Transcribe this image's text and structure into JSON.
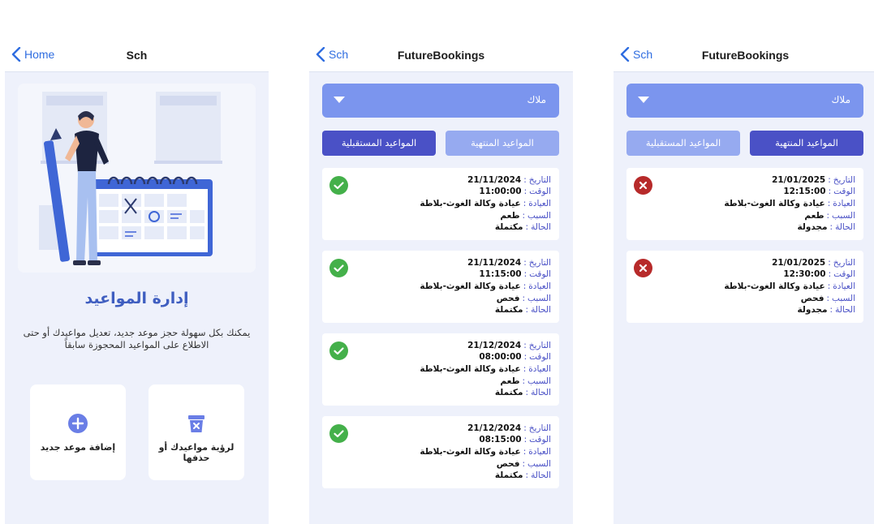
{
  "screen_home": {
    "nav": {
      "back_label": "Home",
      "title": "Sch"
    },
    "title": "إدارة المواعيد",
    "description": "يمكنك بكل سهولة حجز موعد جديد، تعديل مواعيدك أو حتى الاطلاع على المواعيد المحجوزة سابقاً",
    "buttons": [
      {
        "label": "إضافة موعد جديد",
        "icon": "plus-circle-icon"
      },
      {
        "label": "لرؤية مواعيدك أو حذفها",
        "icon": "trash-x-icon"
      }
    ]
  },
  "labels": {
    "date": "التاريخ",
    "time": "الوقت",
    "clinic": "العيادة",
    "reason": "السبب",
    "status": "الحالة",
    "separator": ":"
  },
  "screen_past": {
    "nav": {
      "back_label": "Sch",
      "title": "FutureBookings"
    },
    "dropdown": {
      "selected": "ملاك",
      "icon": "caret-down-icon"
    },
    "tabs": {
      "future": "المواعيد المستقبلية",
      "ended": "المواعيد المنتهية"
    },
    "active_tab": "future",
    "bookings": [
      {
        "date": "21/11/2024",
        "time": "11:00:00",
        "clinic": "عيادة وكالة الغوث-بلاطة",
        "reason": "طعم",
        "status": "مكتملة",
        "icon": "check-circle-icon"
      },
      {
        "date": "21/11/2024",
        "time": "11:15:00",
        "clinic": "عيادة وكالة الغوث-بلاطة",
        "reason": "فحص",
        "status": "مكتملة",
        "icon": "check-circle-icon"
      },
      {
        "date": "21/12/2024",
        "time": "08:00:00",
        "clinic": "عيادة وكالة الغوث-بلاطة",
        "reason": "طعم",
        "status": "مكتملة",
        "icon": "check-circle-icon"
      },
      {
        "date": "21/12/2024",
        "time": "08:15:00",
        "clinic": "عيادة وكالة الغوث-بلاطة",
        "reason": "فحص",
        "status": "مكتملة",
        "icon": "check-circle-icon"
      }
    ]
  },
  "screen_future": {
    "nav": {
      "back_label": "Sch",
      "title": "FutureBookings"
    },
    "dropdown": {
      "selected": "ملاك",
      "icon": "caret-down-icon"
    },
    "tabs": {
      "future": "المواعيد المستقبلية",
      "ended": "المواعيد المنتهية"
    },
    "active_tab": "ended",
    "bookings": [
      {
        "date": "21/01/2025",
        "time": "12:15:00",
        "clinic": "عيادة وكالة الغوث-بلاطة",
        "reason": "طعم",
        "status": "مجدولة",
        "icon": "x-circle-icon"
      },
      {
        "date": "21/01/2025",
        "time": "12:30:00",
        "clinic": "عيادة وكالة الغوث-بلاطة",
        "reason": "فحص",
        "status": "مجدولة",
        "icon": "x-circle-icon"
      }
    ]
  },
  "colors": {
    "accent": "#4a51c6",
    "accent_light": "#96aaf0",
    "dropdown": "#7b95ee",
    "success": "#44b04a",
    "danger": "#b72a2a",
    "nav_link": "#2f6de0"
  }
}
